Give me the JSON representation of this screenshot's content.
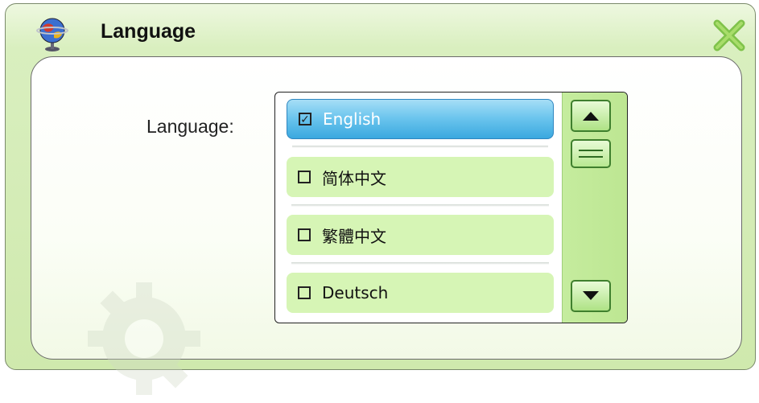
{
  "window": {
    "title": "Language",
    "icon": "globe-icon",
    "close_icon": "close-x-icon"
  },
  "form": {
    "label": "Language:"
  },
  "language_list": {
    "items": [
      {
        "label": "English",
        "checked": true
      },
      {
        "label": "简体中文",
        "checked": false
      },
      {
        "label": "繁體中文",
        "checked": false
      },
      {
        "label": "Deutsch",
        "checked": false
      }
    ],
    "checked_glyph": "☑",
    "unchecked_glyph": ""
  },
  "scrollbar": {
    "up_icon": "arrow-up-icon",
    "down_icon": "arrow-down-icon",
    "thumb_icon": "scroll-thumb-icon"
  },
  "colors": {
    "accent_green": "#3f7f2e",
    "selection_blue": "#3aa8df",
    "item_green": "#d6f5b5"
  }
}
